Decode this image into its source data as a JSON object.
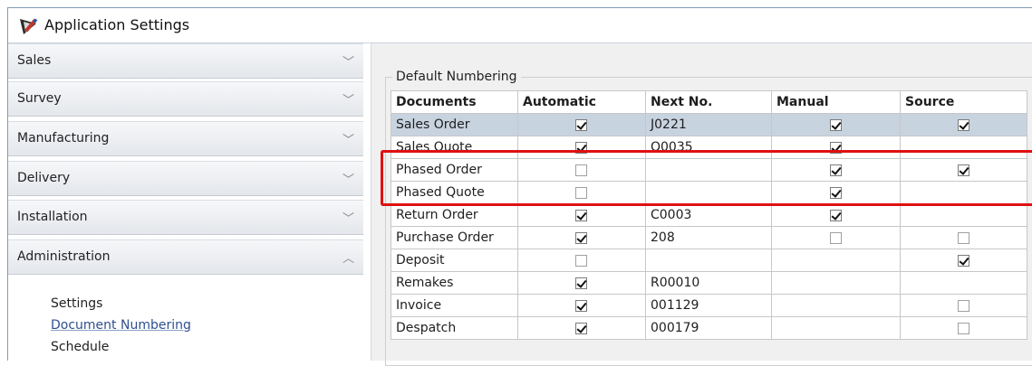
{
  "window": {
    "title": "Application Settings",
    "app_icon": "pen-icon"
  },
  "sidebar": {
    "sections": [
      {
        "label": "Sales",
        "chevron": "chevron-down-icon"
      },
      {
        "label": "Survey",
        "chevron": "chevron-down-icon"
      },
      {
        "label": "Manufacturing",
        "chevron": "chevron-down-icon"
      },
      {
        "label": "Delivery",
        "chevron": "chevron-down-icon"
      },
      {
        "label": "Installation",
        "chevron": "chevron-down-icon"
      },
      {
        "label": "Administration",
        "chevron": "chevron-up-icon"
      }
    ],
    "admin_items": [
      {
        "label": "Settings"
      },
      {
        "label": "Document Numbering",
        "active": true
      },
      {
        "label": "Schedule"
      }
    ]
  },
  "main": {
    "group_title": "Default Numbering",
    "table": {
      "headers": [
        "Documents",
        "Automatic",
        "Next No.",
        "Manual",
        "Source"
      ],
      "rows": [
        {
          "document": "Sales Order",
          "automatic": true,
          "next_no": "J0221",
          "manual": true,
          "source": true,
          "selected": true
        },
        {
          "document": "Sales Quote",
          "automatic": true,
          "next_no": "Q0035",
          "manual": true,
          "source": null
        },
        {
          "document": "Phased Order",
          "automatic": false,
          "next_no": "",
          "manual": true,
          "source": true
        },
        {
          "document": "Phased Quote",
          "automatic": false,
          "next_no": "",
          "manual": true,
          "source": null
        },
        {
          "document": "Return Order",
          "automatic": true,
          "next_no": "C0003",
          "manual": true,
          "source": null
        },
        {
          "document": "Purchase Order",
          "automatic": true,
          "next_no": "208",
          "manual": false,
          "source": false
        },
        {
          "document": "Deposit",
          "automatic": false,
          "next_no": "",
          "manual": null,
          "source": true
        },
        {
          "document": "Remakes",
          "automatic": true,
          "next_no": "R00010",
          "manual": null,
          "source": null
        },
        {
          "document": "Invoice",
          "automatic": true,
          "next_no": "001129",
          "manual": null,
          "source": false
        },
        {
          "document": "Despatch",
          "automatic": true,
          "next_no": "000179",
          "manual": null,
          "source": false
        }
      ]
    },
    "annotation": {
      "highlighted_rows": [
        "Phased Order",
        "Phased Quote"
      ],
      "color": "#e01010"
    }
  }
}
